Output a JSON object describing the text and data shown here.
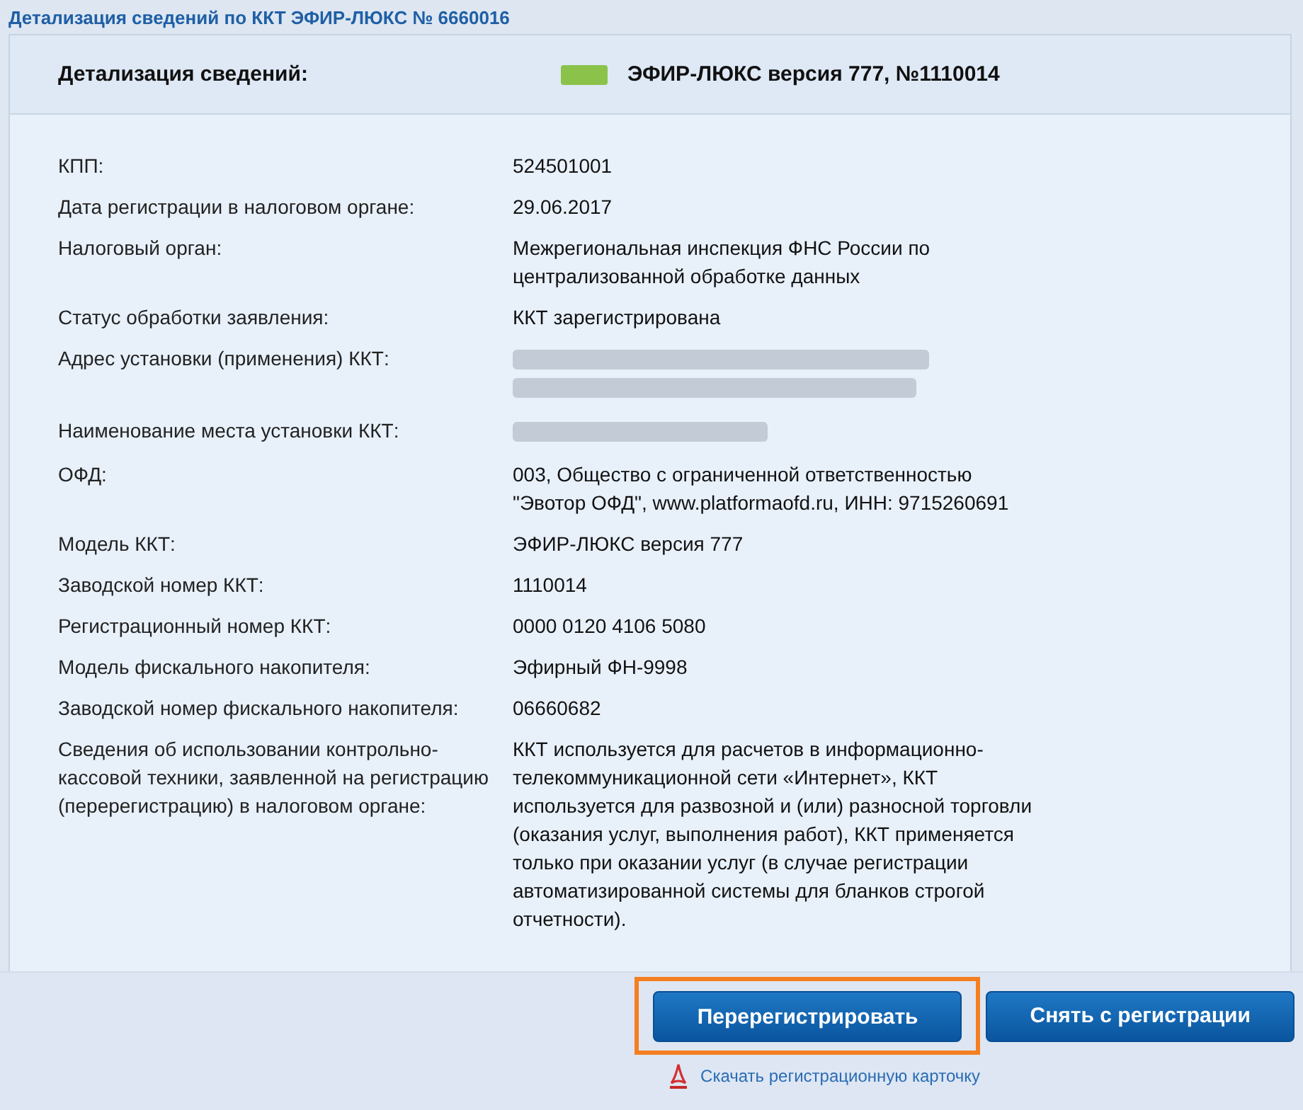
{
  "window": {
    "title": "Детализация сведений по ККТ ЭФИР-ЛЮКС № 6660016"
  },
  "header": {
    "label": "Детализация сведений:",
    "color": "#8bc34a",
    "device": "ЭФИР-ЛЮКС версия 777, №1110014"
  },
  "fields": [
    {
      "label": "КПП:",
      "kind": "text",
      "value": "524501001"
    },
    {
      "label": "Дата регистрации в налоговом органе:",
      "kind": "text",
      "value": "29.06.2017"
    },
    {
      "label": "Налоговый орган:",
      "kind": "text",
      "value": "Межрегиональная инспекция ФНС России по централизованной обработке данных"
    },
    {
      "label": "Статус обработки заявления:",
      "kind": "text",
      "value": "ККТ зарегистрирована"
    },
    {
      "label": "Адрес установки (применения) ККТ:",
      "kind": "blurblock"
    },
    {
      "label": "Наименование места установки ККТ:",
      "kind": "blurline"
    },
    {
      "label": "ОФД:",
      "kind": "text",
      "value": "003, Общество с ограниченной ответственностью \"Эвотор ОФД\", www.platformaofd.ru, ИНН: 9715260691"
    },
    {
      "label": "Модель ККТ:",
      "kind": "text",
      "value": "ЭФИР-ЛЮКС версия 777"
    },
    {
      "label": "Заводской номер ККТ:",
      "kind": "text",
      "value": "1110014"
    },
    {
      "label": "Регистрационный номер ККТ:",
      "kind": "text",
      "value": "0000 0120 4106 5080"
    },
    {
      "label": "Модель фискального накопителя:",
      "kind": "text",
      "value": "Эфирный ФН-9998"
    },
    {
      "label": "Заводской номер фискального накопителя:",
      "kind": "text",
      "value": "06660682"
    },
    {
      "label": "Сведения об использовании контрольно-кассовой техники, заявленной на регистрацию (перерегистрацию) в налоговом органе:",
      "kind": "text",
      "value": "ККТ используется для расчетов в информационно-телекоммуникационной сети «Интернет», ККТ используется для развозной и (или) разносной торговли (оказания услуг, выполнения работ), ККТ применяется только при оказании услуг (в случае регистрации автоматизированной системы для бланков строгой отчетности)."
    }
  ],
  "buttons": [
    {
      "label": "Перерегистрировать",
      "highlighted": true
    },
    {
      "label": "Снять с регистрации",
      "highlighted": false
    }
  ],
  "download_link": "Скачать регистрационную карточку"
}
